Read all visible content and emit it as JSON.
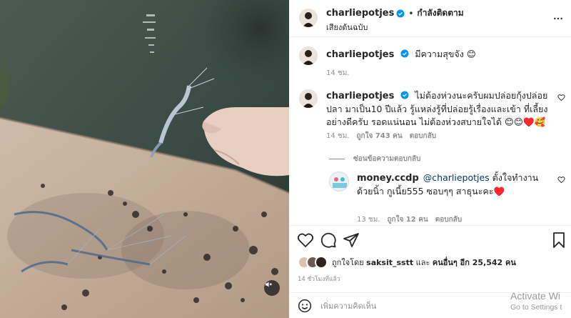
{
  "header": {
    "username": "charliepotjes",
    "follow_status": "กำลังติดตาม",
    "separator": "•",
    "subtitle": "เสียงต้นฉบับ"
  },
  "caption": {
    "username": "charliepotjes",
    "text": "มีความสุขจัง 😊",
    "time": "14 ชม."
  },
  "comments": [
    {
      "username": "charliepotjes",
      "text": "ไม่ต้องห่วงนะครับผมปล่อยกุ้งปล่อยปลา มาเป็น10 ปีแล้ว รู้แหล่งรู้ที่ปล่อยรู้เรื่องและเข้า ที่เลี้ยงอย่างดีครับ รอดแน่นอน ไม่ต้องห่วงสบายใจได้ 😊😊♥️🥰",
      "time": "14 ชม.",
      "likes": "ถูกใจ 743 คน",
      "reply": "ตอบกลับ"
    }
  ],
  "hide_replies": "ซ่อนข้อความตอบกลับ",
  "replies": [
    {
      "username": "money.ccdp",
      "mention": "@charliepotjes",
      "text": "ตั้งใจทำงานด้วยนิ้า กูเนี้ย555 ซอบๆๆ สาธุนะคะ♥️",
      "time": "13 ชม.",
      "likes": "ถูกใจ 12 คน",
      "reply": "ตอบกลับ"
    }
  ],
  "likes_line": {
    "prefix": "ถูกใจโดย",
    "user": "saksit_sstt",
    "middle": "และ",
    "others": "คนอื่นๆ อีก 25,542 คน"
  },
  "time_ago": "14 ชั่วโมงที่แล้ว",
  "add_comment": {
    "placeholder": "เพิ่มความคิดเห็น"
  },
  "watermark": {
    "title": "Activate Wi",
    "subtitle": "Go to Settings t"
  },
  "icons": {
    "more": "more-icon",
    "heart": "heart-icon",
    "comment": "comment-icon",
    "share": "share-icon",
    "save": "bookmark-icon",
    "emoji": "emoji-icon",
    "mute": "mute-icon",
    "verified": "verified-icon"
  },
  "colors": {
    "verified": "#0095f6",
    "heart_red": "#ed4956",
    "link": "#00376b",
    "muted": "#8e8e8e"
  }
}
